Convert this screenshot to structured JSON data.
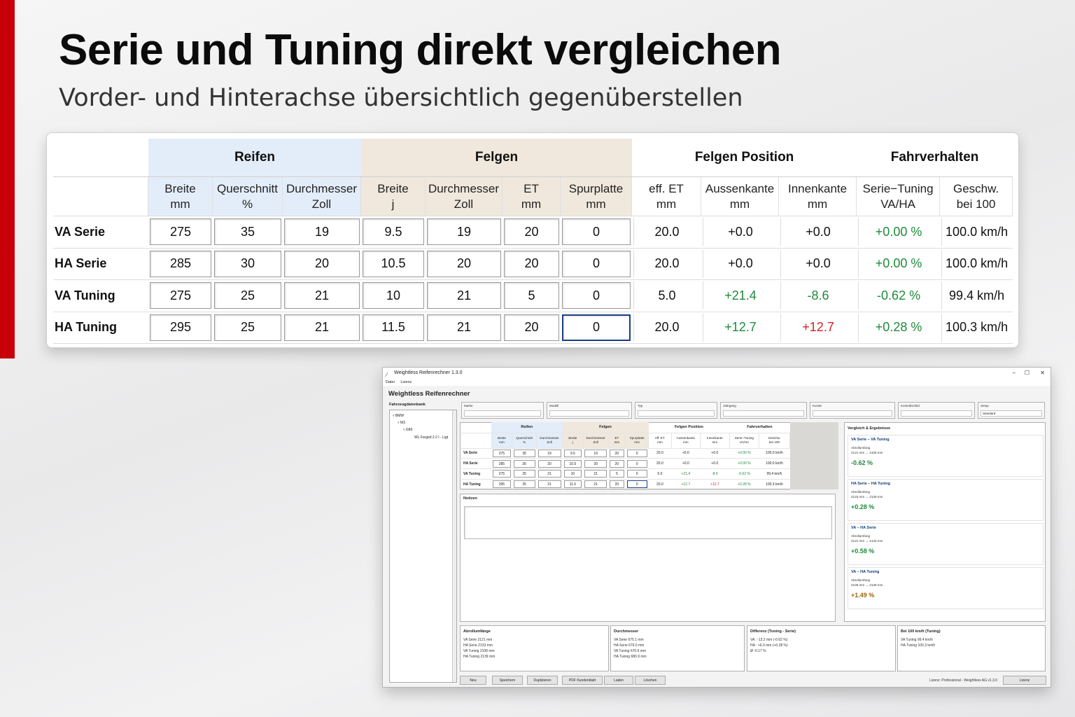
{
  "headline": "Serie und Tuning direkt vergleichen",
  "subheadline": "Vorder- und Hinterachse übersichtlich gegenüberstellen",
  "table": {
    "groups": {
      "reifen": "Reifen",
      "felgen": "Felgen",
      "position": "Felgen Position",
      "fahrverhalten": "Fahrverhalten"
    },
    "columns": {
      "r_breite": [
        "Breite",
        "mm"
      ],
      "r_quer": [
        "Querschnitt",
        "%"
      ],
      "r_durch": [
        "Durchmesser",
        "Zoll"
      ],
      "f_breite": [
        "Breite",
        "j"
      ],
      "f_durch": [
        "Durchmesser",
        "Zoll"
      ],
      "f_et": [
        "ET",
        "mm"
      ],
      "f_spur": [
        "Spurplatte",
        "mm"
      ],
      "p_eff": [
        "eff. ET",
        "mm"
      ],
      "p_aussen": [
        "Aussenkante",
        "mm"
      ],
      "p_innen": [
        "Innenkante",
        "mm"
      ],
      "v_diff": [
        "Serie−Tuning",
        "VA/HA"
      ],
      "v_speed": [
        "Geschw.",
        "bei 100"
      ]
    },
    "rows": [
      {
        "label": "VA Serie",
        "r_breite": "275",
        "r_quer": "35",
        "r_durch": "19",
        "f_breite": "9.5",
        "f_durch": "19",
        "f_et": "20",
        "f_spur": "0",
        "p_eff": "20.0",
        "p_aussen": "+0.0",
        "p_innen": "+0.0",
        "v_diff": "+0.00 %",
        "v_speed": "100.0 km/h"
      },
      {
        "label": "HA Serie",
        "r_breite": "285",
        "r_quer": "30",
        "r_durch": "20",
        "f_breite": "10.5",
        "f_durch": "20",
        "f_et": "20",
        "f_spur": "0",
        "p_eff": "20.0",
        "p_aussen": "+0.0",
        "p_innen": "+0.0",
        "v_diff": "+0.00 %",
        "v_speed": "100.0 km/h"
      },
      {
        "label": "VA Tuning",
        "r_breite": "275",
        "r_quer": "25",
        "r_durch": "21",
        "f_breite": "10",
        "f_durch": "21",
        "f_et": "5",
        "f_spur": "0",
        "p_eff": "5.0",
        "p_aussen": "+21.4",
        "p_innen": "-8.6",
        "v_diff": "-0.62 %",
        "v_speed": "99.4 km/h"
      },
      {
        "label": "HA Tuning",
        "r_breite": "295",
        "r_quer": "25",
        "r_durch": "21",
        "f_breite": "11.5",
        "f_durch": "21",
        "f_et": "20",
        "f_spur": "0",
        "p_eff": "20.0",
        "p_aussen": "+12.7",
        "p_innen": "+12.7",
        "v_diff": "+0.28 %",
        "v_speed": "100.3 km/h"
      }
    ]
  },
  "app": {
    "window_title": "Weightless Reifenrechner 1.3.0",
    "window_controls": [
      "–",
      "☐",
      "✕"
    ],
    "menu": [
      "Datei",
      "Lizenz"
    ],
    "heading": "Weightless Reifenrechner",
    "db_label": "Fahrzeugdatenbank",
    "tree": [
      "▿ BMW",
      "▿ M3",
      "▿ G80",
      "WL Forged 2.2 I - Ligt"
    ],
    "fields": [
      {
        "label": "Marke",
        "value": ""
      },
      {
        "label": "Modell",
        "value": ""
      },
      {
        "label": "Typ",
        "value": ""
      },
      {
        "label": "Jahrgang",
        "value": ""
      },
      {
        "label": "Kunde",
        "value": ""
      },
      {
        "label": "Kontrollschild",
        "value": ""
      },
      {
        "label": "Setup",
        "value": "Standard"
      }
    ],
    "notes_label": "Notizen",
    "results_title": "Vergleich & Ergebnisse",
    "results": [
      {
        "title": "VA Serie – VA Tuning",
        "label": "Abrollumfang",
        "detail": "2121 mm  →  2108 mm",
        "value": "-0.62 %",
        "color": "#1f8a3b"
      },
      {
        "title": "HA Serie – HA Tuning",
        "label": "Abrollumfang",
        "detail": "2133 mm  →  2139 mm",
        "value": "+0.28 %",
        "color": "#1f8a3b"
      },
      {
        "title": "VA – HA Serie",
        "label": "Abrollumfang",
        "detail": "2121 mm  →  2133 mm",
        "value": "+0.58 %",
        "color": "#1f8a3b"
      },
      {
        "title": "VA – HA Tuning",
        "label": "Abrollumfang",
        "detail": "2108 mm  →  2139 mm",
        "value": "+1.49 %",
        "color": "#a06410"
      }
    ],
    "bottom": [
      {
        "title": "Abrollumfänge",
        "lines": [
          "VA Serie   2121 mm",
          "HA Serie   2133 mm",
          "VA Tuning   2108 mm",
          "HA Tuning   2139 mm"
        ]
      },
      {
        "title": "Durchmesser",
        "lines": [
          "VA Serie   675.1 mm",
          "HA Serie   679.0 mm",
          "VA Tuning   670.9 mm",
          "HA Tuning   680.9 mm"
        ]
      },
      {
        "title": "Differenz (Tuning - Serie)",
        "lines": [
          "VA : -13.2 mm  (-0.62 %)",
          "HA : +6.0 mm  (+0.28 %)",
          "Ø   -0.17 %"
        ]
      },
      {
        "title": "Bei 100 km/h (Tuning)",
        "lines": [
          "VA Tuning   99.4 km/h",
          "HA Tuning   100.3 km/h"
        ]
      }
    ],
    "buttons": [
      "Neu",
      "Speichern",
      "Duplizieren",
      "PDF Kundenblatt",
      "Laden",
      "Löschen"
    ],
    "footer": "Lizenz: Professional - Weightless AG    v1.3.0",
    "license_button": "Lizenz"
  }
}
